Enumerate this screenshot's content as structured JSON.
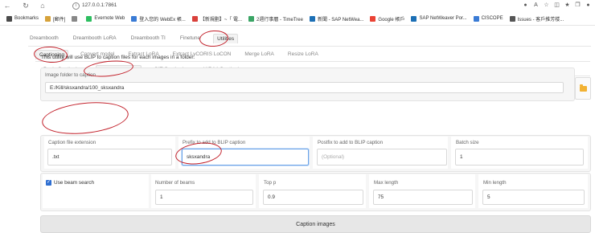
{
  "browser": {
    "url": "127.0.0.1:7861",
    "bookmarks": [
      {
        "label": "Bookmarks",
        "color": "#4a4a4a"
      },
      {
        "label": "[郵件]",
        "color": "#d6a23a"
      },
      {
        "label": "",
        "color": "#888888"
      },
      {
        "label": "Evernote Web",
        "color": "#2dbe60"
      },
      {
        "label": "登入您的 WebEx 帳...",
        "color": "#3a7bd5"
      },
      {
        "label": "【新規劃】~「 電...",
        "color": "#d9413b"
      },
      {
        "label": "2週行事曆 - TimeTree",
        "color": "#3aa565"
      },
      {
        "label": "新聞 - SAP NetWea...",
        "color": "#1c6fb5"
      },
      {
        "label": "Google 帳戶",
        "color": "#ea4335"
      },
      {
        "label": "SAP NetWeaver Por...",
        "color": "#1c6fb5"
      },
      {
        "label": "CISCOPE",
        "color": "#3a7bd5"
      },
      {
        "label": "Issues - 客戶推芳楼...",
        "color": "#555555"
      }
    ]
  },
  "tabs_main": [
    "Dreambooth",
    "Dreambooth LoRA",
    "Dreambooth TI",
    "Finetune",
    "Utilities"
  ],
  "tabs_utilities": [
    "Captioning",
    "Convert model",
    "Extract LoRA",
    "Extract LyCORIS LoCON",
    "Merge LoRA",
    "Resize LoRA"
  ],
  "tabs_captioning": [
    "Basic Captioning",
    "BLIP Captioning",
    "GIT Captioning",
    "WD14 Captioning"
  ],
  "description": "This utility will use BLIP to caption files for each images in a folder.",
  "form": {
    "image_folder": {
      "label": "Image folder to caption",
      "value": "E:/Kill/sksxandra/100_sksxandra"
    },
    "caption_ext": {
      "label": "Caption file extension",
      "value": ".txt"
    },
    "prefix": {
      "label": "Prefix to add to BLIP caption",
      "value": "sksxandra"
    },
    "postfix": {
      "label": "Postfix to add to BLIP caption",
      "placeholder": "(Optional)"
    },
    "batch_size": {
      "label": "Batch size",
      "value": "1"
    },
    "beam_search": {
      "label": "Use beam search",
      "checked": true
    },
    "num_beams": {
      "label": "Number of beams",
      "value": "1"
    },
    "top_p": {
      "label": "Top p",
      "value": "0.9"
    },
    "max_length": {
      "label": "Max length",
      "value": "75"
    },
    "min_length": {
      "label": "Min length",
      "value": "5"
    }
  },
  "actions": {
    "caption_button": "Caption images"
  },
  "colors": {
    "accent": "#2f6fd1",
    "annotation": "#c2202a",
    "folder": "#f2b233"
  }
}
